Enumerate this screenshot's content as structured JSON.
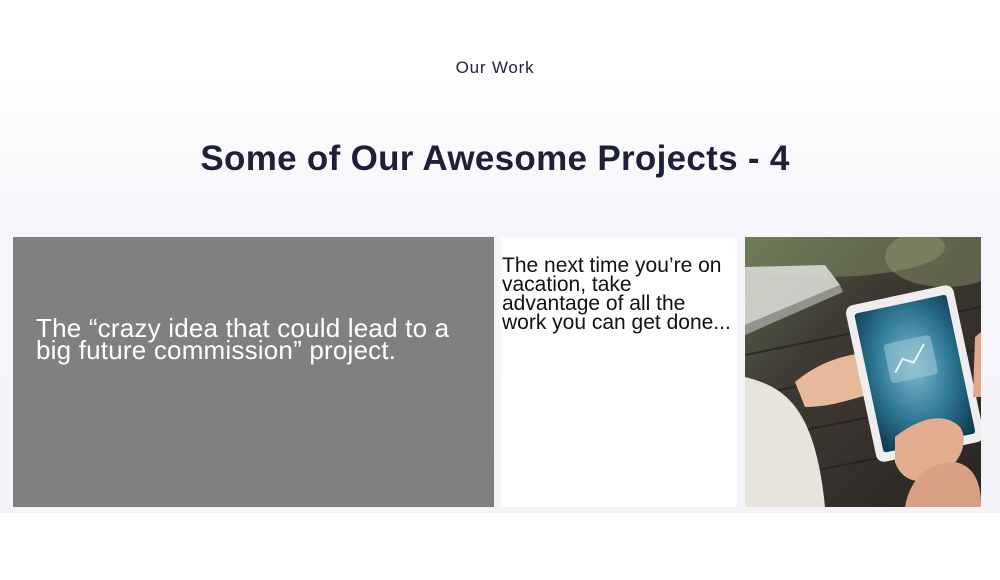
{
  "section": {
    "eyebrow": "Our Work",
    "heading": "Some of Our Awesome Projects - 4"
  },
  "cards": [
    {
      "type": "text-overlay",
      "title": "The “crazy idea that could lead to a big future commission” project."
    },
    {
      "type": "text",
      "text": "The next time you’re on vacation, take advantage of all the work you can get done..."
    },
    {
      "type": "image",
      "image_subject": "hands holding a tablet showing a chart, on a wooden table"
    }
  ],
  "colors": {
    "heading": "#1e2038",
    "card_overlay_bg": "#808080",
    "card_text_bg": "#ffffff"
  }
}
